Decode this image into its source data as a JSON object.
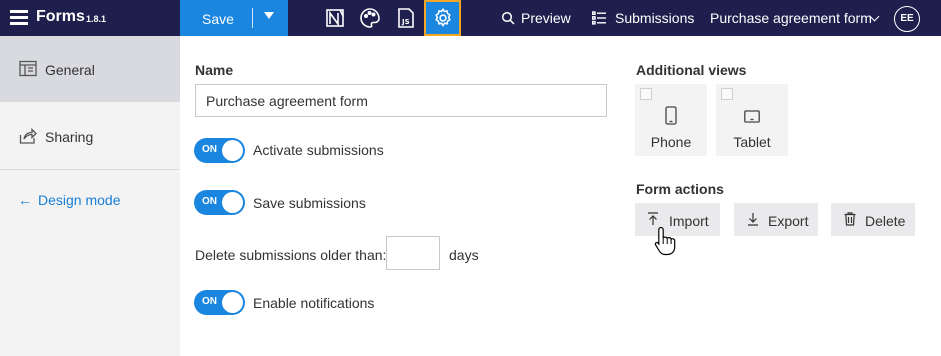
{
  "topbar": {
    "app_title": "Forms",
    "version": "1.8.1",
    "save_label": "Save",
    "preview_label": "Preview",
    "submissions_label": "Submissions",
    "form_name": "Purchase agreement form",
    "avatar_initials": "EE",
    "accent_color": "#1a86e0",
    "bar_color": "#1e1f4d"
  },
  "sidebar": {
    "items": [
      {
        "label": "General",
        "icon": "general-icon",
        "active": true
      },
      {
        "label": "Sharing",
        "icon": "share-icon",
        "active": false
      }
    ],
    "design_mode_label": "Design mode"
  },
  "general": {
    "name_label": "Name",
    "name_value": "Purchase agreement form",
    "toggles": [
      {
        "state_label": "ON",
        "label": "Activate submissions"
      },
      {
        "state_label": "ON",
        "label": "Save submissions"
      },
      {
        "state_label": "ON",
        "label": "Enable notifications"
      }
    ],
    "delete_label": "Delete submissions older than:",
    "delete_days_value": "",
    "days_label": "days"
  },
  "additional_views": {
    "title": "Additional views",
    "views": [
      {
        "label": "Phone",
        "checked": false
      },
      {
        "label": "Tablet",
        "checked": false
      }
    ]
  },
  "form_actions": {
    "title": "Form actions",
    "actions": [
      {
        "label": "Import",
        "icon": "import-icon"
      },
      {
        "label": "Export",
        "icon": "export-icon"
      },
      {
        "label": "Delete",
        "icon": "trash-icon"
      }
    ]
  }
}
